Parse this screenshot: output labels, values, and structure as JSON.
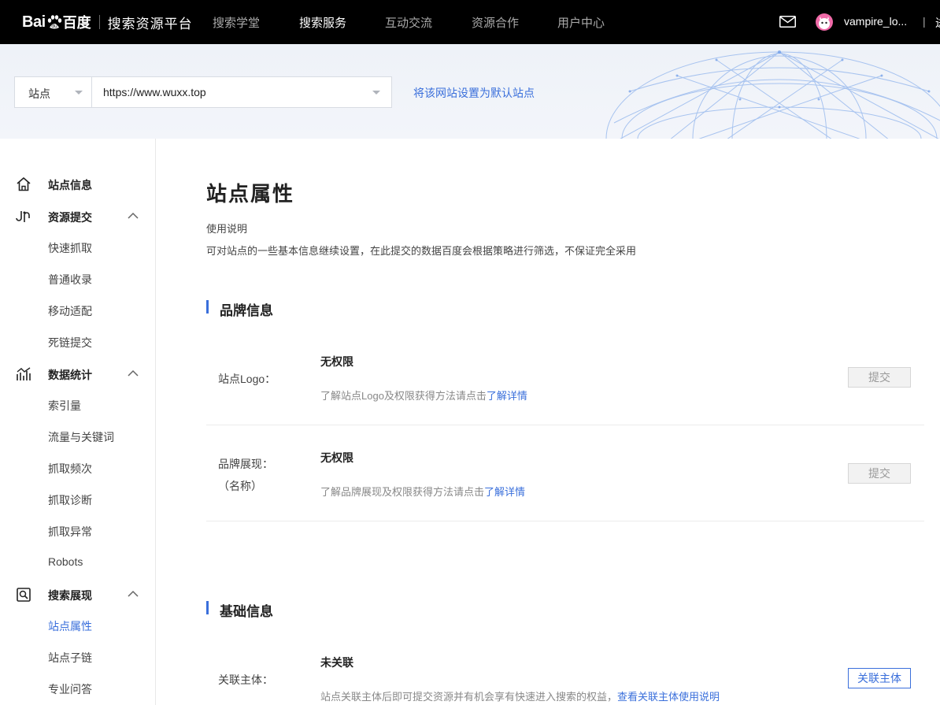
{
  "header": {
    "logo_text": "Bai",
    "logo_cn": "百度",
    "product_title": "搜索资源平台",
    "nav": [
      {
        "label": "搜索学堂",
        "active": false
      },
      {
        "label": "搜索服务",
        "active": true
      },
      {
        "label": "互动交流",
        "active": false
      },
      {
        "label": "资源合作",
        "active": false
      },
      {
        "label": "用户中心",
        "active": false
      }
    ],
    "username": "vampire_lo...",
    "separator": "|",
    "overflow_char": "进"
  },
  "banner": {
    "site_select_label": "站点",
    "site_url": "https://www.wuxx.top",
    "set_default_link": "将该网站设置为默认站点"
  },
  "sidebar": {
    "groups": [
      {
        "label": "站点信息",
        "icon": "home-icon",
        "expandable": false,
        "items": []
      },
      {
        "label": "资源提交",
        "icon": "submit-icon",
        "expandable": true,
        "expanded": true,
        "items": [
          {
            "label": "快速抓取"
          },
          {
            "label": "普通收录"
          },
          {
            "label": "移动适配"
          },
          {
            "label": "死链提交"
          }
        ]
      },
      {
        "label": "数据统计",
        "icon": "chart-icon",
        "expandable": true,
        "expanded": true,
        "items": [
          {
            "label": "索引量"
          },
          {
            "label": "流量与关键词"
          },
          {
            "label": "抓取频次"
          },
          {
            "label": "抓取诊断"
          },
          {
            "label": "抓取异常"
          },
          {
            "label": "Robots"
          }
        ]
      },
      {
        "label": "搜索展现",
        "icon": "search-display-icon",
        "expandable": true,
        "expanded": true,
        "items": [
          {
            "label": "站点属性",
            "active": true
          },
          {
            "label": "站点子链"
          },
          {
            "label": "专业问答"
          }
        ]
      }
    ]
  },
  "main": {
    "title": "站点属性",
    "usage_title": "使用说明",
    "usage_desc": "可对站点的一些基本信息继续设置，在此提交的数据百度会根据策略进行筛选，不保证完全采用",
    "sections": [
      {
        "title": "品牌信息",
        "rows": [
          {
            "label": "站点Logo：",
            "status": "无权限",
            "desc": "了解站点Logo及权限获得方法请点击",
            "link": "了解详情",
            "button": "提交"
          },
          {
            "label": "品牌展现：",
            "sublabel": "（名称）",
            "status": "无权限",
            "desc": "了解品牌展现及权限获得方法请点击",
            "link": "了解详情",
            "button": "提交"
          }
        ]
      },
      {
        "title": "基础信息",
        "rows": [
          {
            "label": "关联主体：",
            "status": "未关联",
            "desc": "站点关联主体后即可提交资源并有机会享有快速进入搜索的权益，",
            "link": "查看关联主体使用说明",
            "button": "关联主体"
          }
        ]
      }
    ]
  },
  "colors": {
    "accent": "#3a6fdb",
    "topbar_bg": "#000000",
    "banner_bg": "#eef2f8",
    "avatar": "#f06aa8"
  }
}
